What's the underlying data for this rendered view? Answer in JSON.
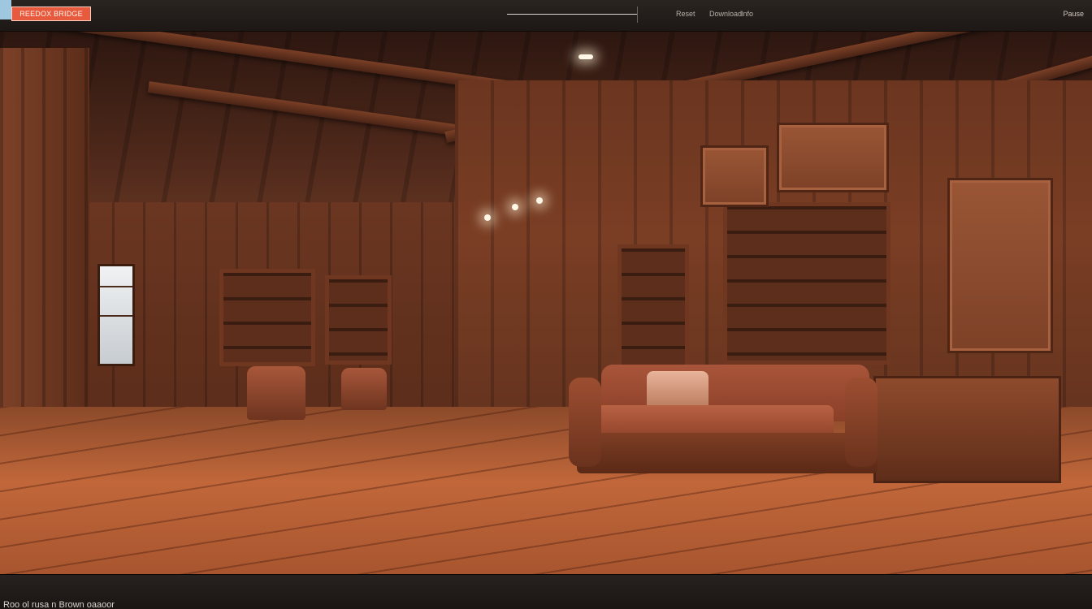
{
  "top_bar": {
    "brand": "REEDOX BRIDGE",
    "progress_percent": 100,
    "menu": [
      "Reset",
      "Download",
      "Info"
    ],
    "right_label": "Pause"
  },
  "bottom_bar": {
    "caption": "Roo ol rusa n Brown oaaoor"
  },
  "colors": {
    "brand_badge": "#e85a3e",
    "chrome": "#1d1815"
  }
}
